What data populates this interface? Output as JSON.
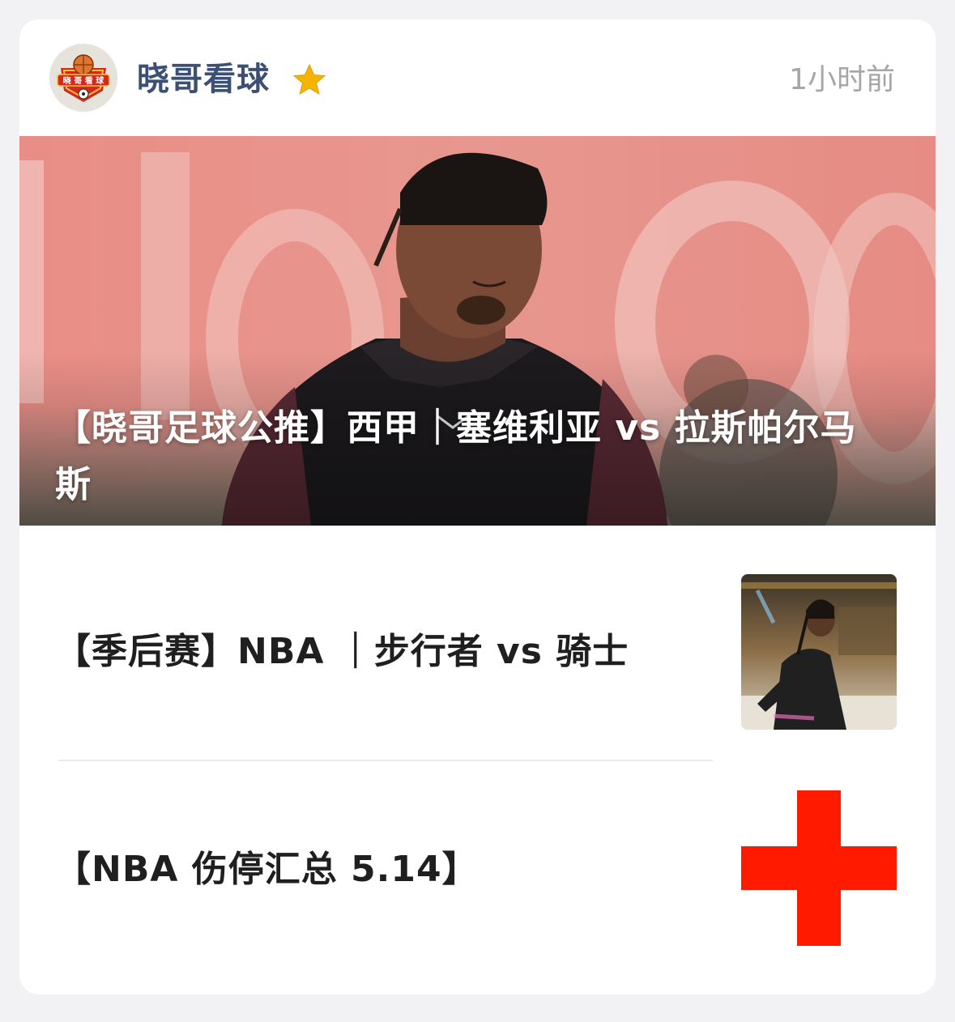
{
  "header": {
    "account_name": "晓哥看球",
    "avatar_icon": "basketball-club-logo-icon",
    "badge_icon": "star-icon",
    "time": "1小时前"
  },
  "hero": {
    "title": "【晓哥足球公推】西甲｜塞维利亚 vs 拉斯帕尔马斯"
  },
  "articles": [
    {
      "title": "【季后赛】NBA ｜步行者 vs 骑士",
      "thumb": "basketball-player-photo"
    },
    {
      "title": "【NBA 伤停汇总 5.14】",
      "thumb": "red-cross-icon"
    }
  ],
  "colors": {
    "account_name": "#3c4f75",
    "time": "#a6a6a6",
    "red_cross": "#ff1a00",
    "star": "#f5b400"
  }
}
